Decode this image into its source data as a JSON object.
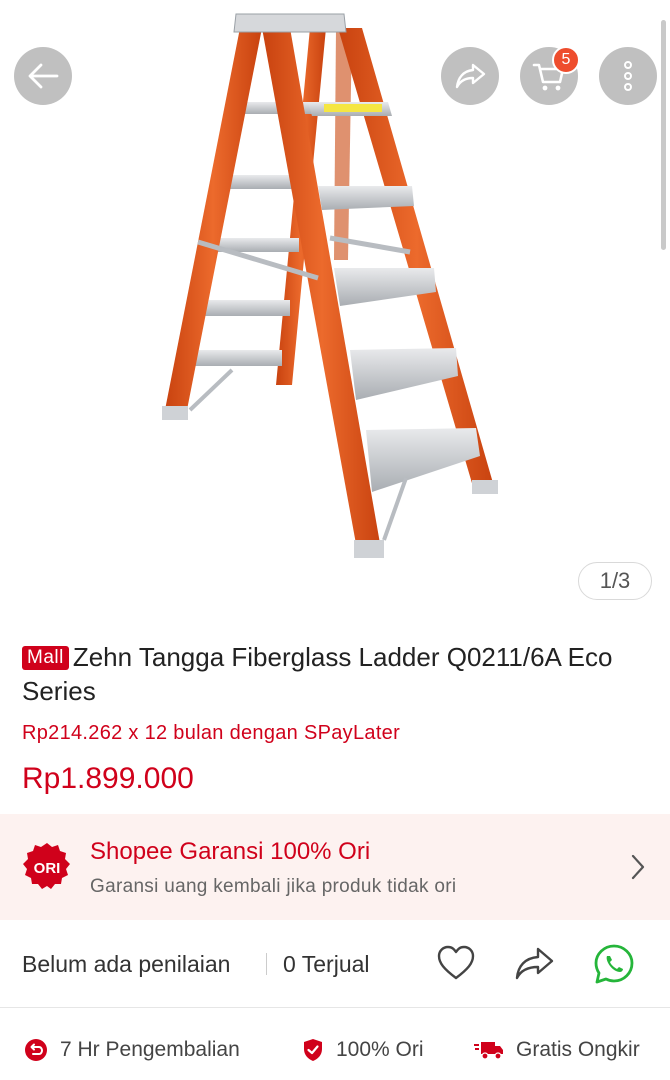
{
  "header": {
    "cart_count": "5",
    "icons": {
      "back": "back-arrow-icon",
      "share": "share-icon",
      "cart": "cart-icon",
      "more": "more-vertical-icon"
    }
  },
  "gallery": {
    "counter": "1/3"
  },
  "product": {
    "mall_badge": "Mall",
    "title": "Zehn Tangga Fiberglass Ladder Q0211/6A Eco Series",
    "installment": "Rp214.262 x 12 bulan dengan SPayLater",
    "price": "Rp1.899.000"
  },
  "guarantee": {
    "badge": "ORI",
    "title": "Shopee Garansi 100% Ori",
    "subtitle": "Garansi uang kembali jika produk tidak ori"
  },
  "stats": {
    "rating": "Belum ada penilaian",
    "sold": "0 Terjual"
  },
  "services": [
    {
      "label": "7 Hr Pengembalian",
      "icon": "return-icon"
    },
    {
      "label": "100% Ori",
      "icon": "shield-check-icon"
    },
    {
      "label": "Gratis Ongkir",
      "icon": "delivery-truck-icon"
    }
  ],
  "colors": {
    "brand_red": "#d0011b",
    "shopee_orange": "#ee4d2d",
    "whatsapp_green": "#25b53a",
    "ladder_orange": "#e0571f"
  }
}
